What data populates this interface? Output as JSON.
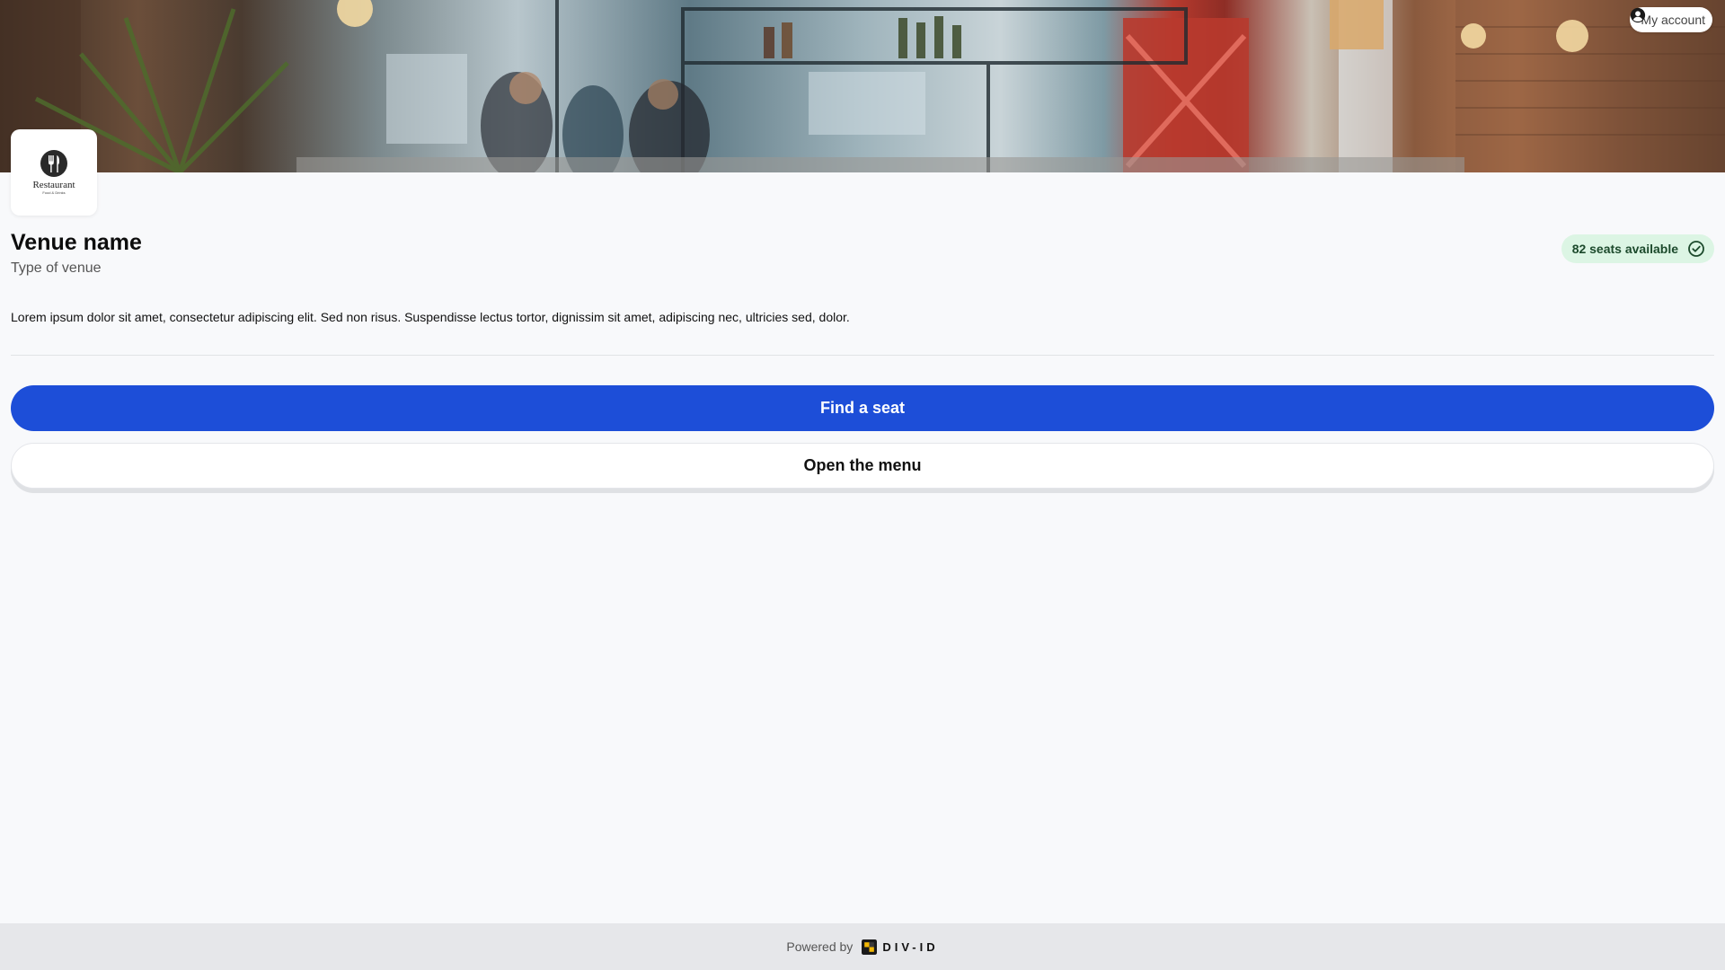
{
  "account": {
    "label": "My account",
    "icon": "user-circle-icon"
  },
  "venue": {
    "logo_name": "Restaurant",
    "logo_sub": "Food & Drinks",
    "logo_icon": "fork-knife-icon",
    "name": "Venue name",
    "type": "Type of venue",
    "description": "Lorem ipsum dolor sit amet, consectetur adipiscing elit. Sed non risus. Suspendisse lectus tortor, dignissim sit amet, adipiscing nec, ultricies sed, dolor."
  },
  "seats": {
    "label": "82 seats available",
    "icon": "check-circle-icon"
  },
  "actions": {
    "primary_label": "Find a seat",
    "secondary_label": "Open the menu"
  },
  "footer": {
    "powered_by": "Powered by",
    "brand": "DIV-ID",
    "brand_icon": "div-id-logo-icon"
  },
  "colors": {
    "primary": "#1d4ed8",
    "badge_bg": "#dcf5e4",
    "badge_text": "#1c4a2c",
    "footer_bg": "#e6e7ea",
    "page_bg": "#f8f9fb"
  }
}
